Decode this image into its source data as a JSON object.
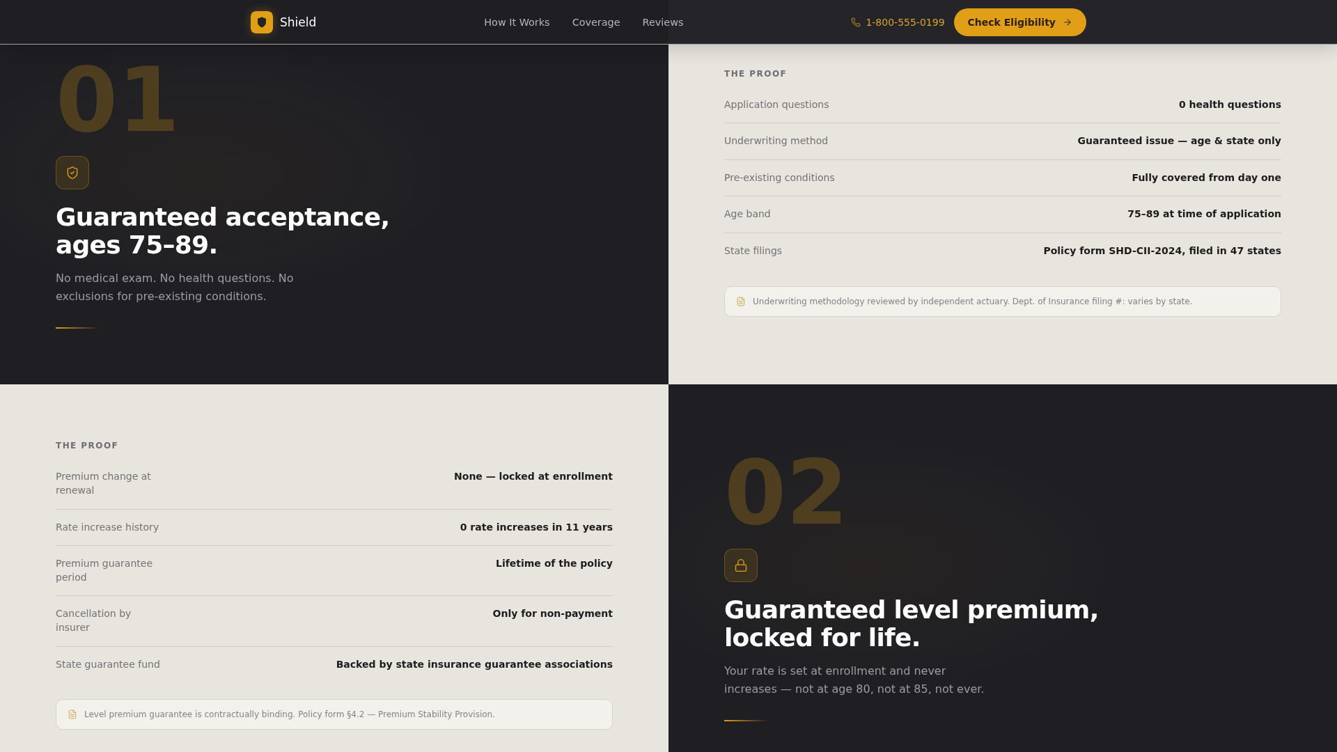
{
  "header": {
    "brand": "Shield",
    "nav": [
      "How It Works",
      "Coverage",
      "Reviews"
    ],
    "phone": "1-800-555-0199",
    "cta": "Check Eligibility"
  },
  "sections": [
    {
      "kind": "claim",
      "number": "01",
      "title": "Guaranteed acceptance, ages 75–89.",
      "text": "No medical exam. No health questions. No exclusions for pre-existing conditions."
    },
    {
      "kind": "proof",
      "eyebrow": "THE PROOF",
      "rows": [
        {
          "label": "Application questions",
          "value": "0 health questions"
        },
        {
          "label": "Underwriting method",
          "value": "Guaranteed issue — age & state only"
        },
        {
          "label": "Pre-existing conditions",
          "value": "Fully covered from day one"
        },
        {
          "label": "Age band",
          "value": "75–89 at time of application"
        },
        {
          "label": "State filings",
          "value": "Policy form SHD-CII-2024, filed in 47 states"
        }
      ],
      "note": "Underwriting methodology reviewed by independent actuary. Dept. of Insurance filing #: varies by state."
    },
    {
      "kind": "proof",
      "eyebrow": "THE PROOF",
      "rows": [
        {
          "label": "Premium change at renewal",
          "value": "None — locked at enrollment"
        },
        {
          "label": "Rate increase history",
          "value": "0 rate increases in 11 years"
        },
        {
          "label": "Premium guarantee period",
          "value": "Lifetime of the policy"
        },
        {
          "label": "Cancellation by insurer",
          "value": "Only for non-payment"
        },
        {
          "label": "State guarantee fund",
          "value": "Backed by state insurance guarantee associations"
        }
      ],
      "note": "Level premium guarantee is contractually binding. Policy form §4.2 — Premium Stability Provision."
    },
    {
      "kind": "claim",
      "number": "02",
      "title": "Guaranteed level premium, locked for life.",
      "text": "Your rate is set at enrollment and never increases — not at age 80, not at 85, not ever."
    }
  ]
}
